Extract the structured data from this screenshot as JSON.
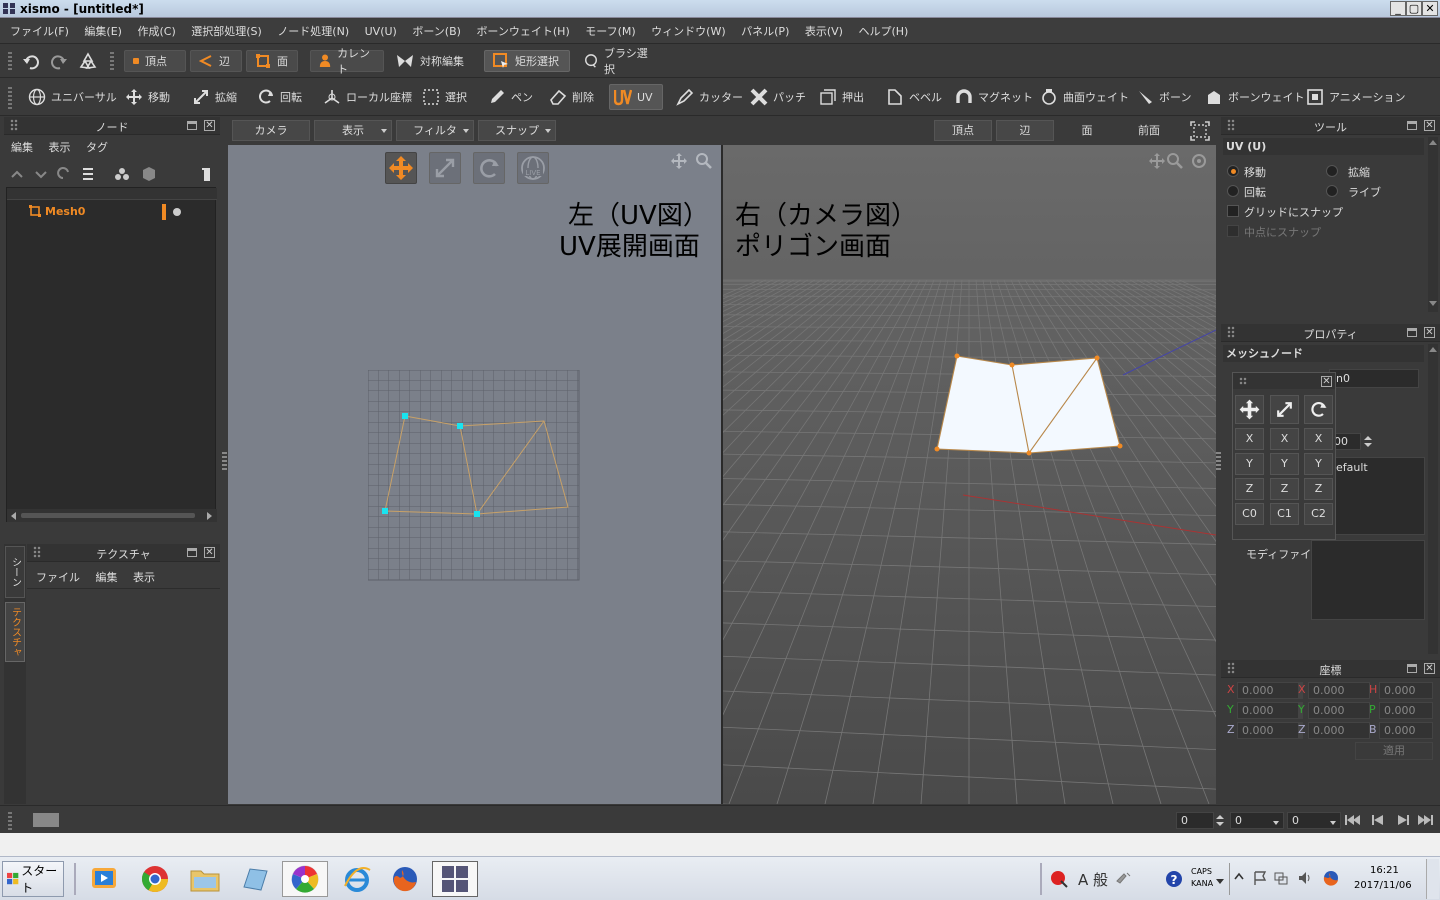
{
  "window": {
    "title": "xismo - [untitled*]",
    "min": "_",
    "max": "▢",
    "close": "✕"
  },
  "menu": [
    "ファイル(F)",
    "編集(E)",
    "作成(C)",
    "選択部処理(S)",
    "ノード処理(N)",
    "UV(U)",
    "ボーン(B)",
    "ボーンウェイト(H)",
    "モーフ(M)",
    "ウィンドウ(W)",
    "パネル(P)",
    "表示(V)",
    "ヘルプ(H)"
  ],
  "toolbar1": {
    "vertex": "頂点",
    "edge": "辺",
    "face": "面",
    "current": "カレント",
    "symmetry": "対称編集",
    "rect_select": "矩形選択",
    "brush_select": "ブラシ選択"
  },
  "toolbar2": [
    "ユニバーサル",
    "移動",
    "拡縮",
    "回転",
    "ローカル座標",
    "選択",
    "ペン",
    "削除",
    "UV",
    "カッター",
    "パッチ",
    "押出",
    "ベベル",
    "マグネット",
    "曲面ウェイト",
    "ボーン",
    "ボーンウェイト",
    "アニメーション"
  ],
  "node_panel": {
    "title": "ノード",
    "menu": [
      "編集",
      "表示",
      "タグ"
    ],
    "mesh_name": "Mesh0"
  },
  "texture_panel": {
    "title": "テクスチャ",
    "menu": [
      "ファイル",
      "編集",
      "表示"
    ]
  },
  "side_tabs": {
    "scene": "シーン",
    "texture": "テクスチャ"
  },
  "viewport_toolbar": {
    "camera": "カメラ",
    "display": "表示",
    "filter": "フィルタ",
    "snap": "スナップ",
    "vertex": "頂点",
    "edge": "辺",
    "face": "面",
    "front": "前面"
  },
  "annotations": {
    "left_l1": "左（UV図）",
    "left_l2": "UV展開画面",
    "right_l1": "右（カメラ図）",
    "right_l2": "ポリゴン画面"
  },
  "tool_panel": {
    "title": "ツール",
    "section": "UV (U)",
    "move": "移動",
    "scale": "拡縮",
    "rotate": "回転",
    "live": "ライブ",
    "grid_snap": "グリッドにスナップ",
    "midpoint_snap": "中点にスナップ"
  },
  "property_panel": {
    "title": "プロパティ",
    "section": "メッシュノード",
    "name_partial": "n0",
    "num_partial": "00",
    "material_partial": "efault",
    "modifier": "モディファイア"
  },
  "toolpad": {
    "x": "X",
    "y": "Y",
    "z": "Z",
    "c0": "C0",
    "c1": "C1",
    "c2": "C2"
  },
  "coord_panel": {
    "title": "座標",
    "x": "X",
    "y": "Y",
    "z": "Z",
    "h": "H",
    "p": "P",
    "b": "B",
    "value": "0.000",
    "apply": "適用"
  },
  "status": {
    "frame": "0",
    "v1": "0",
    "v2": "0"
  },
  "taskbar": {
    "start": "スタート",
    "ime": "A 般",
    "caps": "CAPS",
    "kana": "KANA",
    "time": "16:21",
    "date": "2017/11/06"
  },
  "colors": {
    "accent": "#f08a24",
    "uv_point": "#19e3ef",
    "surface": "#f3f9ff"
  }
}
